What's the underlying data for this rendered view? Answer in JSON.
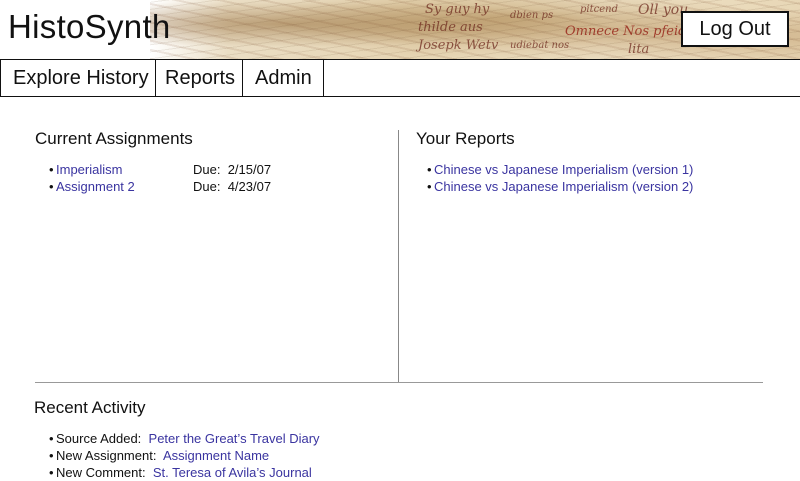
{
  "header": {
    "logo": "HistoSynth",
    "logout_label": "Log Out",
    "background_script": [
      "Sy guy hy",
      "thilde aus",
      "Josepk Wetv",
      "Omnece Nos pfeiditer",
      "dbien ps",
      "udiebat nos",
      "Oll you",
      "pitcend",
      "lita"
    ]
  },
  "nav": {
    "items": [
      {
        "label": "Explore History"
      },
      {
        "label": "Reports"
      },
      {
        "label": "Admin"
      }
    ]
  },
  "assignments": {
    "title": "Current Assignments",
    "items": [
      {
        "name": "Imperialism",
        "due_label": "Due:",
        "due": "2/15/07"
      },
      {
        "name": "Assignment 2",
        "due_label": "Due:",
        "due": "4/23/07"
      }
    ]
  },
  "reports": {
    "title": "Your Reports",
    "items": [
      {
        "name": "Chinese vs Japanese Imperialism (version 1)"
      },
      {
        "name": "Chinese vs Japanese Imperialism (version 2)"
      }
    ]
  },
  "activity": {
    "title": "Recent Activity",
    "items": [
      {
        "label": "Source Added:",
        "value": "Peter the Great’s Travel Diary"
      },
      {
        "label": "New Assignment:",
        "value": "Assignment Name"
      },
      {
        "label": "New Comment:",
        "value": "St. Teresa of Avila’s Journal"
      }
    ]
  },
  "colors": {
    "link": "#3a34a0",
    "text": "#111111",
    "divider": "#888888"
  }
}
